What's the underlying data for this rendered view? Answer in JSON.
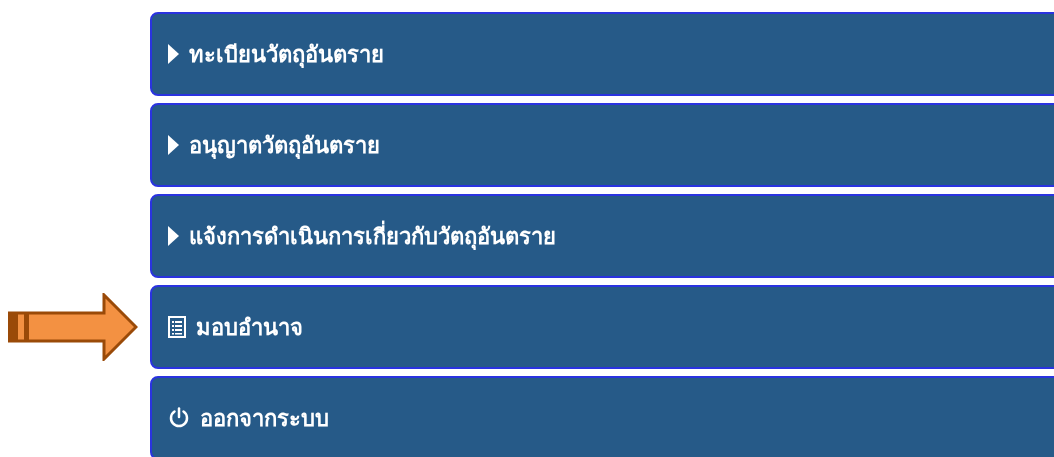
{
  "menu": [
    {
      "kind": "expander",
      "label": "ทะเบียนวัตถุอันตราย",
      "pointed": false
    },
    {
      "kind": "expander",
      "label": "อนุญาตวัตถุอันตราย",
      "pointed": false
    },
    {
      "kind": "expander",
      "label": "แจ้งการดำเนินการเกี่ยวกับวัตถุอันตราย",
      "pointed": false
    },
    {
      "kind": "list",
      "label": "มอบอำนาจ",
      "pointed": true
    },
    {
      "kind": "power",
      "label": "ออกจากระบบ",
      "pointed": false
    }
  ]
}
